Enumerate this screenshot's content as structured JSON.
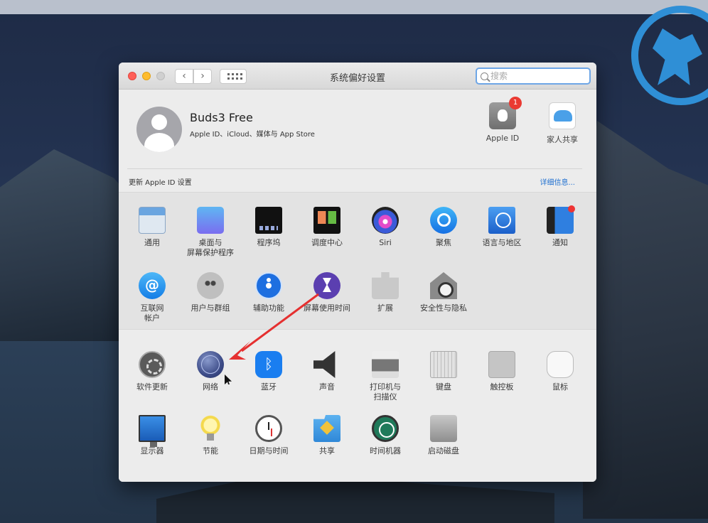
{
  "window": {
    "title": "系统偏好设置",
    "nav_back": "‹",
    "nav_forward": "›"
  },
  "search": {
    "placeholder": "搜索",
    "value": ""
  },
  "account": {
    "name": "Buds3 Free",
    "subtitle": "Apple ID、iCloud、媒体与 App Store",
    "apple_id_label": "Apple ID",
    "apple_id_badge": "1",
    "family_label": "家人共享",
    "update_text": "更新 Apple ID 设置",
    "details_link": "详细信息..."
  },
  "panes_row1": [
    {
      "label": "通用",
      "icon": "general-icon"
    },
    {
      "label": "桌面与\n屏幕保护程序",
      "icon": "desktop-icon"
    },
    {
      "label": "程序坞",
      "icon": "dock-icon"
    },
    {
      "label": "调度中心",
      "icon": "mission-control-icon"
    },
    {
      "label": "Siri",
      "icon": "siri-icon"
    },
    {
      "label": "聚焦",
      "icon": "spotlight-icon"
    },
    {
      "label": "语言与地区",
      "icon": "language-icon"
    },
    {
      "label": "通知",
      "icon": "notifications-icon"
    }
  ],
  "panes_row2": [
    {
      "label": "互联网\n帐户",
      "icon": "internet-accounts-icon"
    },
    {
      "label": "用户与群组",
      "icon": "users-icon"
    },
    {
      "label": "辅助功能",
      "icon": "accessibility-icon"
    },
    {
      "label": "屏幕使用时间",
      "icon": "screen-time-icon"
    },
    {
      "label": "扩展",
      "icon": "extensions-icon"
    },
    {
      "label": "安全性与隐私",
      "icon": "security-icon"
    }
  ],
  "panes_row3": [
    {
      "label": "软件更新",
      "icon": "software-update-icon"
    },
    {
      "label": "网络",
      "icon": "network-icon"
    },
    {
      "label": "蓝牙",
      "icon": "bluetooth-icon"
    },
    {
      "label": "声音",
      "icon": "sound-icon"
    },
    {
      "label": "打印机与\n扫描仪",
      "icon": "printer-icon"
    },
    {
      "label": "键盘",
      "icon": "keyboard-icon"
    },
    {
      "label": "触控板",
      "icon": "trackpad-icon"
    },
    {
      "label": "鼠标",
      "icon": "mouse-icon"
    }
  ],
  "panes_row4": [
    {
      "label": "显示器",
      "icon": "displays-icon"
    },
    {
      "label": "节能",
      "icon": "energy-saver-icon"
    },
    {
      "label": "日期与时间",
      "icon": "date-time-icon"
    },
    {
      "label": "共享",
      "icon": "sharing-icon"
    },
    {
      "label": "时间机器",
      "icon": "time-machine-icon"
    },
    {
      "label": "启动磁盘",
      "icon": "startup-disk-icon"
    }
  ],
  "colors": {
    "annotation_arrow": "#e53030",
    "accent_link": "#1e6fd0"
  }
}
